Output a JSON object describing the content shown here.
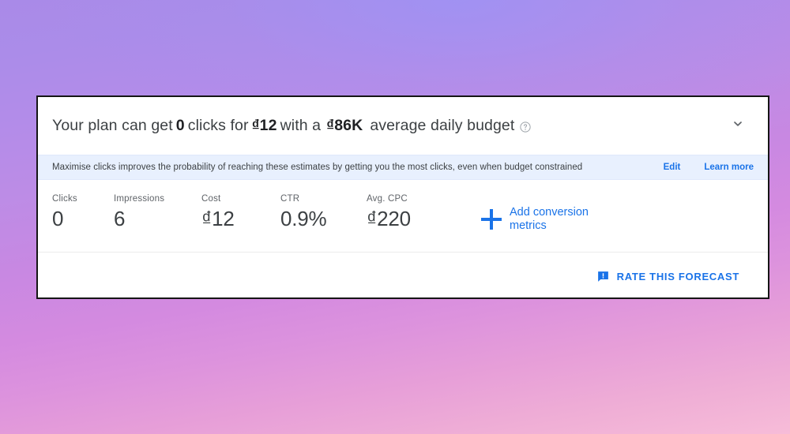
{
  "background": {
    "gradient_from": "#a98ae8",
    "gradient_to": "#f7bcd8"
  },
  "card": {
    "header": {
      "text_prefix": "Your plan can get",
      "clicks_value": "0",
      "text_mid": "clicks for",
      "cost_value": "₫12",
      "text_with": "with a",
      "budget_value": "₫86K",
      "text_suffix": "average daily budget",
      "help_icon": "help-circle-icon",
      "collapse_icon": "chevron-down-icon"
    },
    "info_band": {
      "message": "Maximise clicks improves the probability of reaching these estimates by getting you the most clicks, even when budget constrained",
      "edit_label": "Edit",
      "learn_more_label": "Learn more",
      "background_color": "#e8f0fe",
      "link_color": "#1a73e8"
    },
    "metrics": [
      {
        "label": "Clicks",
        "value": "0"
      },
      {
        "label": "Impressions",
        "value": "6"
      },
      {
        "label": "Cost",
        "value": "₫12"
      },
      {
        "label": "CTR",
        "value": "0.9%"
      },
      {
        "label": "Avg. CPC",
        "value": "₫220"
      }
    ],
    "add_conversion": {
      "icon": "plus-icon",
      "label": "Add conversion metrics",
      "color": "#1a73e8"
    },
    "footer": {
      "rate_button_label": "RATE THIS FORECAST",
      "rate_button_icon": "feedback-icon",
      "color": "#1a73e8"
    }
  }
}
